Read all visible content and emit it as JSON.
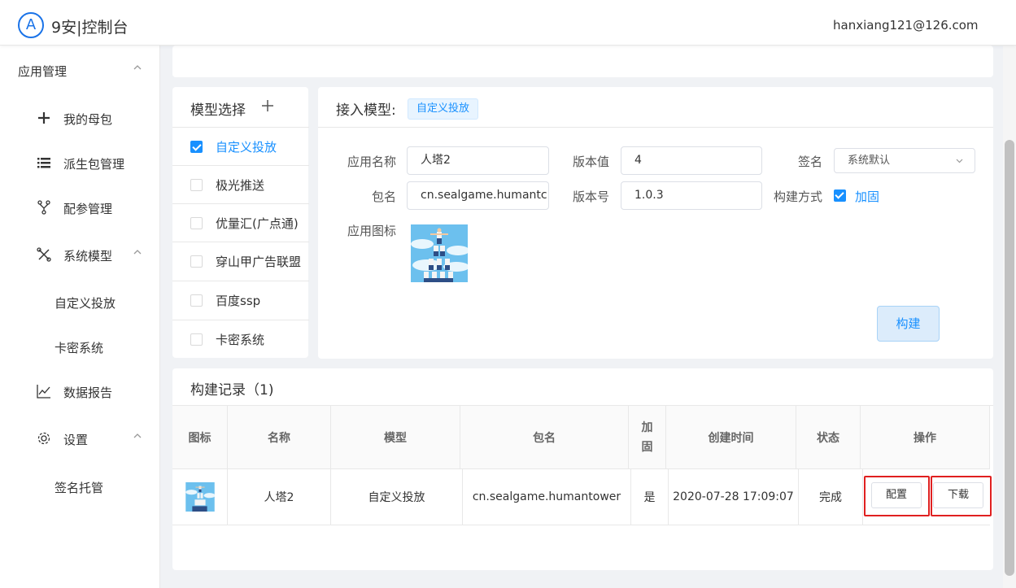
{
  "header": {
    "logo_letter": "A",
    "title": "9安|控制台",
    "user_email": "hanxiang121@126.com"
  },
  "sidebar": {
    "items": [
      {
        "label": "应用管理",
        "icon": "none",
        "chevron": "up"
      },
      {
        "label": "我的母包",
        "icon": "plus-icon"
      },
      {
        "label": "派生包管理",
        "icon": "list-icon"
      },
      {
        "label": "配参管理",
        "icon": "fork-icon"
      },
      {
        "label": "系统模型",
        "icon": "tools-icon",
        "chevron": "up"
      },
      {
        "label": "自定义投放",
        "icon": "none"
      },
      {
        "label": "卡密系统",
        "icon": "none"
      },
      {
        "label": "数据报告",
        "icon": "chart-line-icon"
      },
      {
        "label": "设置",
        "icon": "gear-icon",
        "chevron": "up"
      },
      {
        "label": "签名托管",
        "icon": "none"
      }
    ]
  },
  "model_select": {
    "title": "模型选择",
    "items": [
      {
        "label": "自定义投放",
        "checked": true
      },
      {
        "label": "极光推送",
        "checked": false
      },
      {
        "label": "优量汇(广点通)",
        "checked": false
      },
      {
        "label": "穿山甲广告联盟",
        "checked": false
      },
      {
        "label": "百度ssp",
        "checked": false
      },
      {
        "label": "卡密系统",
        "checked": false
      }
    ]
  },
  "access": {
    "title": "接入模型:",
    "tag": "自定义投放",
    "form": {
      "app_name_label": "应用名称",
      "app_name_value": "人塔2",
      "version_value_label": "版本值",
      "version_value": "4",
      "sign_label": "签名",
      "sign_value": "系统默认",
      "package_label": "包名",
      "package_value": "cn.sealgame.humantc",
      "version_no_label": "版本号",
      "version_no_value": "1.0.3",
      "build_method_label": "构建方式",
      "build_method_value": "加固",
      "app_icon_label": "应用图标"
    },
    "build_button": "构建"
  },
  "records": {
    "title": "构建记录（1)",
    "columns": [
      "图标",
      "名称",
      "模型",
      "包名",
      "加\n固",
      "创建时间",
      "状态",
      "操作"
    ],
    "rows": [
      {
        "name": "人塔2",
        "model": "自定义投放",
        "package": "cn.sealgame.humantower",
        "hardened": "是",
        "created": "2020-07-28 17:09:07",
        "status": "完成",
        "config_button": "配置",
        "download_button": "下载"
      }
    ]
  },
  "colors": {
    "primary": "#1890ff",
    "highlight_border": "#e02020",
    "logo": "#1a73e8"
  }
}
